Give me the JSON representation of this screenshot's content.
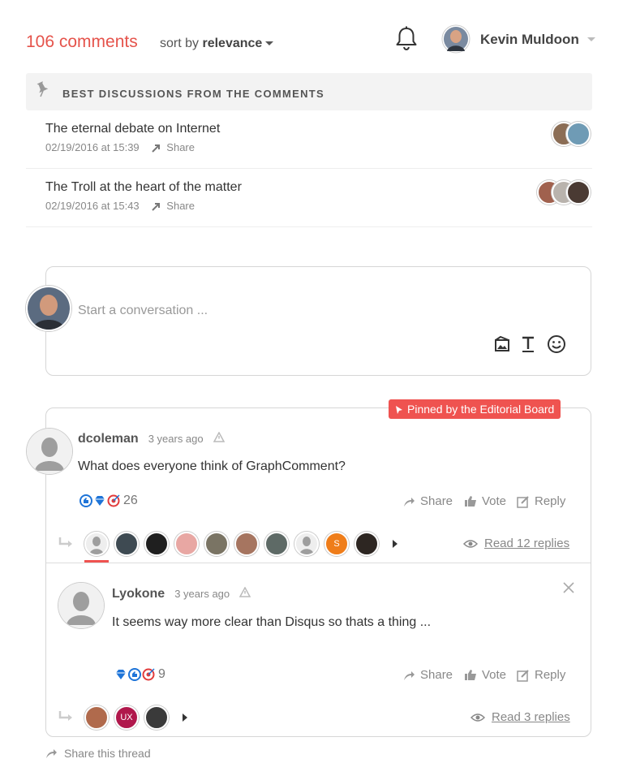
{
  "header": {
    "comment_count": "106 comments",
    "sort_prefix": "sort by ",
    "sort_value": "relevance",
    "user_name": "Kevin Muldoon"
  },
  "best": {
    "title": "BEST DISCUSSIONS FROM THE COMMENTS",
    "items": [
      {
        "title": "The eternal debate on Internet",
        "date": "02/19/2016 at 15:39",
        "share": "Share"
      },
      {
        "title": "The Troll at the heart of the matter",
        "date": "02/19/2016 at 15:43",
        "share": "Share"
      }
    ]
  },
  "composer": {
    "placeholder": "Start a conversation ..."
  },
  "thread": {
    "pinned_label": "Pinned by the Editorial Board",
    "comment": {
      "author": "dcoleman",
      "time": "3 years ago",
      "text": "What does everyone think of GraphComment?",
      "reaction_count": "26",
      "share": "Share",
      "vote": "Vote",
      "reply": "Reply",
      "read_replies": "Read 12 replies",
      "orange_avatar_letter": "S"
    },
    "reply": {
      "author": "Lyokone",
      "time": "3 years ago",
      "text": "It seems way more clear than Disqus so thats a thing ...",
      "reaction_count": "9",
      "share": "Share",
      "vote": "Vote",
      "reply": "Reply",
      "read_replies": "Read 3 replies",
      "ux_avatar_label": "UX"
    },
    "share_thread": "Share this thread"
  },
  "colors": {
    "accent": "#ef5350",
    "count_red": "#e5534b",
    "muted": "#888888"
  }
}
